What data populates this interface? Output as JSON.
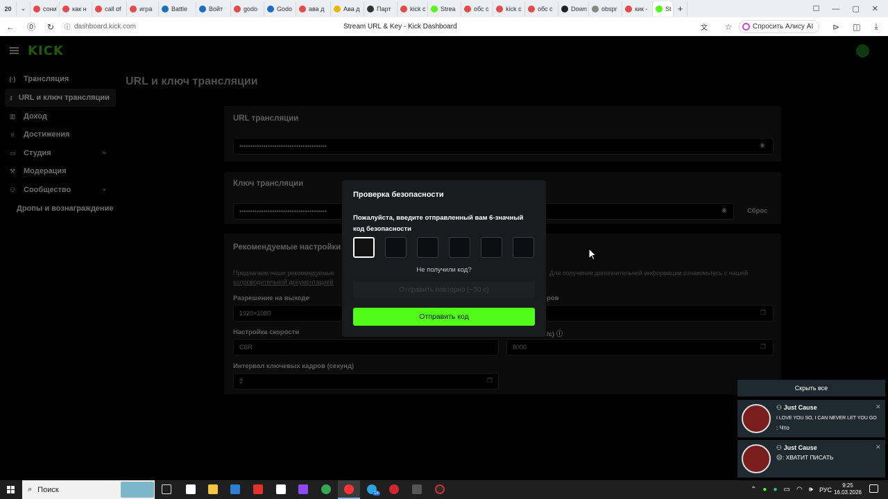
{
  "browser": {
    "tab_count_badge": "20",
    "tabs": [
      {
        "label": "сони",
        "color": "#e54b4b"
      },
      {
        "label": "как н",
        "color": "#e54b4b"
      },
      {
        "label": "call of",
        "color": "#e54b4b"
      },
      {
        "label": "игра",
        "color": "#e54b4b"
      },
      {
        "label": "Battle",
        "color": "#1b6ec2"
      },
      {
        "label": "Войт",
        "color": "#1b6ec2"
      },
      {
        "label": "godo",
        "color": "#e54b4b"
      },
      {
        "label": "Godo",
        "color": "#1b6ec2"
      },
      {
        "label": "ава д",
        "color": "#e54b4b"
      },
      {
        "label": "Ава д",
        "color": "#e8b700"
      },
      {
        "label": "Парт",
        "color": "#333333"
      },
      {
        "label": "kick c",
        "color": "#e54b4b"
      },
      {
        "label": "Strea",
        "color": "#53fc18"
      },
      {
        "label": "обс с",
        "color": "#e54b4b"
      },
      {
        "label": "kick c",
        "color": "#e54b4b"
      },
      {
        "label": "обс с",
        "color": "#e54b4b"
      },
      {
        "label": "Down",
        "color": "#222222"
      },
      {
        "label": "obspr",
        "color": "#888888"
      },
      {
        "label": "кик -",
        "color": "#e54b4b"
      },
      {
        "label": "St",
        "color": "#53fc18"
      }
    ],
    "url": "dashboard.kick.com",
    "page_title": "Stream URL & Key - Kick Dashboard",
    "alice_label": "Спросить Алису AI"
  },
  "logo": "KICK",
  "sidebar": {
    "items": [
      {
        "label": "Трансляция",
        "icon": "broadcast-icon"
      },
      {
        "label": "URL и ключ трансляции",
        "icon": "key-icon"
      },
      {
        "label": "Доход",
        "icon": "chart-icon"
      },
      {
        "label": "Достижения",
        "icon": "trophy-icon"
      },
      {
        "label": "Студия",
        "icon": "studio-icon"
      },
      {
        "label": "Модерация",
        "icon": "hammer-icon"
      },
      {
        "label": "Сообщество",
        "icon": "people-icon"
      },
      {
        "label": "Дропы и вознаграждение",
        "icon": ""
      }
    ]
  },
  "main": {
    "title": "URL и ключ трансляции",
    "url_section": {
      "title": "URL трансляции",
      "value": "••••••••••••••••••••••••••••••••••••••••"
    },
    "key_section": {
      "title": "Ключ трансляции",
      "value": "••••••••••••••••••••••••••••••••••••••••",
      "reset": "Сброс"
    },
    "recommended": {
      "title": "Рекомендуемые настройки",
      "desc_left": "Предлагаем наши рекомендуемые",
      "desc_right": "Для получения дополнительной информации ознакомьтесь с нашей",
      "desc_link": "сопроводительной документацией",
      "resolution_label": "Разрешение на выходе",
      "resolution_value": "1920×1080",
      "fps_label_fragment": "ров",
      "rate_control_label": "Настройка скорости",
      "rate_control_value": "CBR",
      "bitrate_label_fragment": "/с)",
      "bitrate_value": "8000",
      "keyframe_label": "Интервал ключевых кадров (секунд)",
      "keyframe_value": "2"
    }
  },
  "modal": {
    "title": "Проверка безопасности",
    "prompt": "Пожалуйста, введите отправленный вам 6-значный код безопасности",
    "resend_question": "Не получили код?",
    "resend_button": "Отправить повторно (~30 с)",
    "submit": "Отправить код",
    "code_digits": [
      "",
      "",
      "",
      "",
      "",
      ""
    ]
  },
  "notifications": {
    "hide_all": "Скрыть все",
    "items": [
      {
        "sender": "Just Cause",
        "line1": "I LOVE YOU SO, I CAN NEVER LET YOU GO",
        "line2": ": Что"
      },
      {
        "sender": "Just Cause",
        "line1": ": ХВАТИТ ПИСАТЬ",
        "line2": ""
      }
    ]
  },
  "taskbar": {
    "search": "Поиск",
    "lang": "РУС",
    "time": "9:25",
    "date": "16.03.2026",
    "badge": "18"
  },
  "colors": {
    "accent": "#53fc18",
    "modal_bg": "#191b1c",
    "page_bg": "#000000"
  }
}
